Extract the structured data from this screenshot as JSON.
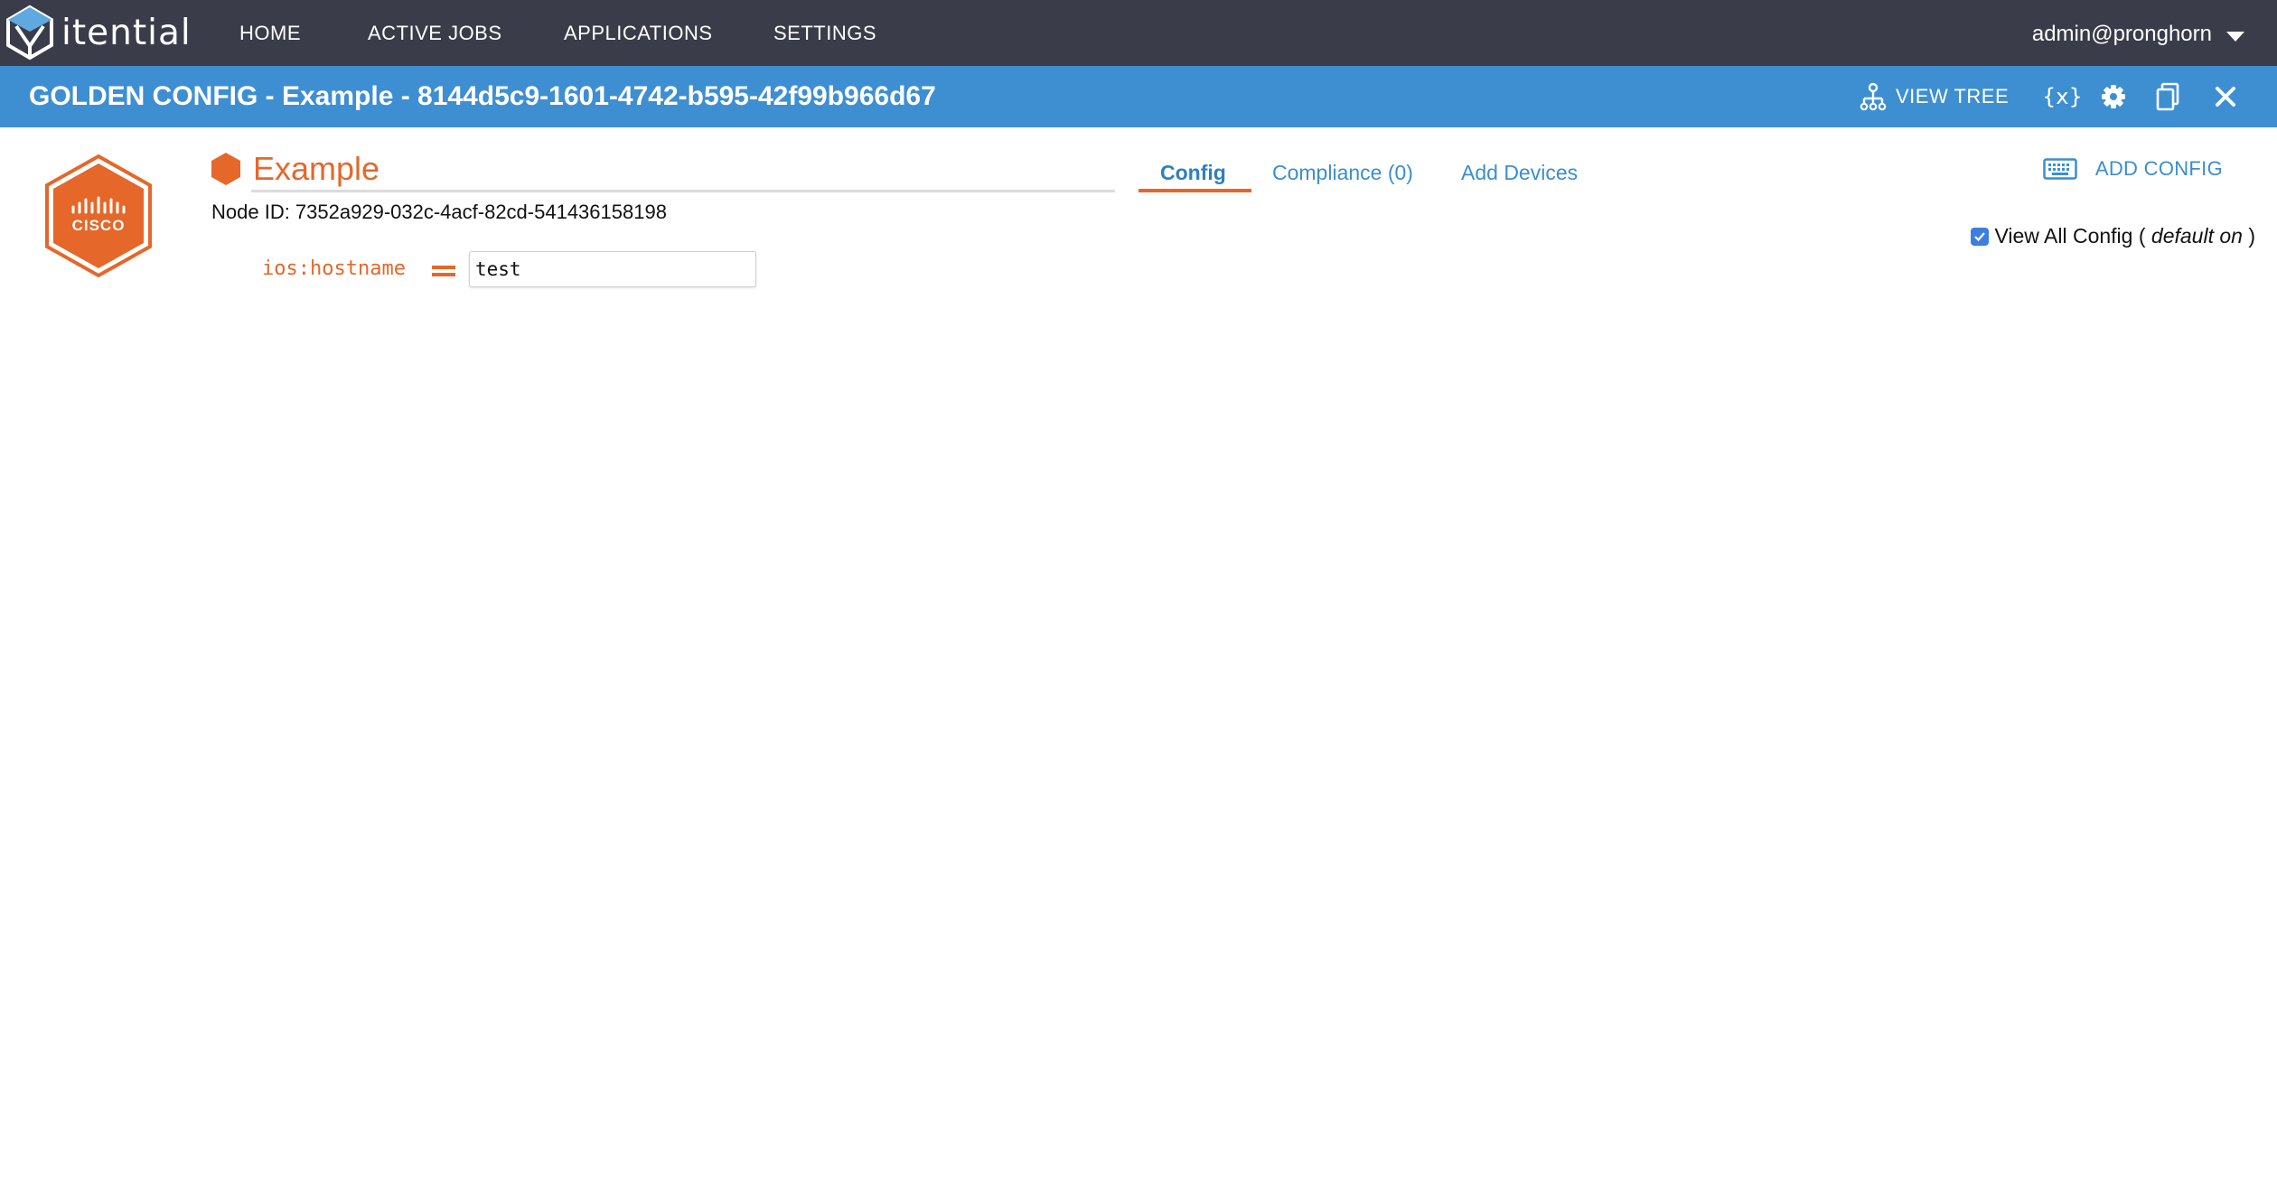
{
  "brand": {
    "name": "itential"
  },
  "nav": {
    "items": [
      {
        "label": "HOME"
      },
      {
        "label": "ACTIVE JOBS"
      },
      {
        "label": "APPLICATIONS"
      },
      {
        "label": "SETTINGS"
      }
    ],
    "user": "admin@pronghorn"
  },
  "titlebar": {
    "title": "GOLDEN CONFIG - Example - 8144d5c9-1601-4742-b595-42f99b966d67",
    "view_tree_label": "VIEW TREE",
    "variables_label": "{x}"
  },
  "node": {
    "device_logo_text": "CISCO",
    "title": "Example",
    "id_text": "Node ID: 7352a929-032c-4acf-82cd-541436158198"
  },
  "tabs": [
    {
      "label": "Config",
      "active": true
    },
    {
      "label": "Compliance (0)",
      "active": false
    },
    {
      "label": "Add Devices",
      "active": false
    }
  ],
  "add_config_label": "ADD CONFIG",
  "view_all": {
    "label": "View All Config (",
    "default_label": "default on",
    "close_paren": ")",
    "checked": true
  },
  "config_lines": [
    {
      "key": "ios:hostname",
      "operator": "=",
      "value": "test"
    }
  ],
  "colors": {
    "topnav_bg": "#3a3c4a",
    "titlebar_bg": "#3e8fd1",
    "accent_orange": "#e5672a",
    "link_blue": "#3a8ed0"
  }
}
